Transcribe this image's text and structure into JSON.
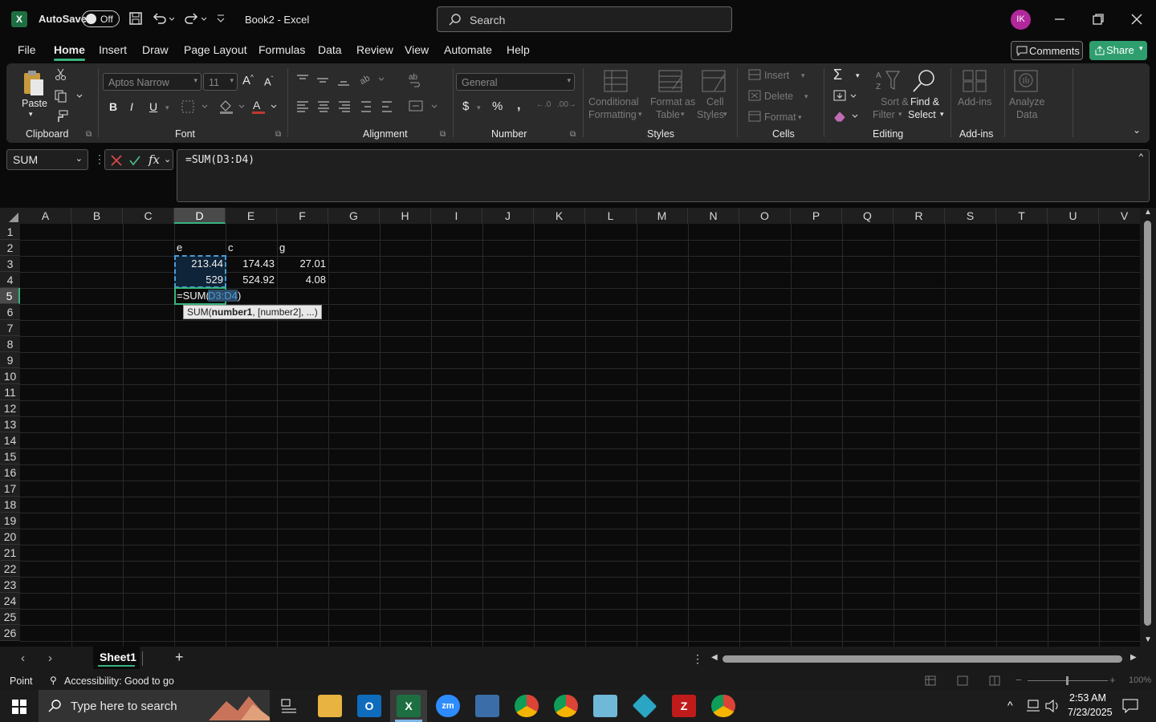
{
  "titlebar": {
    "autosave_label": "AutoSave",
    "autosave_state": "Off",
    "doc_title": "Book2  -  Excel",
    "search_placeholder": "Search",
    "avatar_initials": "IK"
  },
  "tabs": [
    "File",
    "Home",
    "Insert",
    "Draw",
    "Page Layout",
    "Formulas",
    "Data",
    "Review",
    "View",
    "Automate",
    "Help"
  ],
  "active_tab": "Home",
  "comments_label": "Comments",
  "share_label": "Share",
  "ribbon": {
    "clipboard": {
      "group": "Clipboard",
      "paste": "Paste"
    },
    "font": {
      "group": "Font",
      "font_name": "Aptos Narrow",
      "font_size": "11"
    },
    "alignment": {
      "group": "Alignment"
    },
    "number": {
      "group": "Number",
      "format": "General"
    },
    "styles": {
      "group": "Styles",
      "conditional_line1": "Conditional",
      "conditional_line2": "Formatting",
      "format_table_line1": "Format as",
      "format_table_line2": "Table",
      "cell_styles_line1": "Cell",
      "cell_styles_line2": "Styles"
    },
    "cells": {
      "group": "Cells",
      "insert": "Insert",
      "delete": "Delete",
      "format": "Format"
    },
    "editing": {
      "group": "Editing",
      "sort_line1": "Sort &",
      "sort_line2": "Filter",
      "find_line1": "Find &",
      "find_line2": "Select"
    },
    "addins": {
      "group": "Add-ins",
      "addins_label": "Add-ins",
      "analyze_line1": "Analyze",
      "analyze_line2": "Data"
    }
  },
  "formula_bar": {
    "name_box": "SUM",
    "formula": "=SUM(D3:D4)"
  },
  "columns": [
    "A",
    "B",
    "C",
    "D",
    "E",
    "F",
    "G",
    "H",
    "I",
    "J",
    "K",
    "L",
    "M",
    "N",
    "O",
    "P",
    "Q",
    "R",
    "S",
    "T",
    "U",
    "V"
  ],
  "rows": [
    "1",
    "2",
    "3",
    "4",
    "5",
    "6",
    "7",
    "8",
    "9",
    "10",
    "11",
    "12",
    "13",
    "14",
    "15",
    "16",
    "17",
    "18",
    "19",
    "20",
    "21",
    "22",
    "23",
    "24",
    "25",
    "26"
  ],
  "cells": {
    "D2": "e",
    "E2": "c",
    "F2": "g",
    "D3": "213.44",
    "E3": "174.43",
    "F3": "27.01",
    "D4": "529",
    "E4": "524.92",
    "F4": "4.08",
    "D5_prefix": "=SUM(",
    "D5_ref": "D3:D4",
    "D5_suffix": ")"
  },
  "tooltip": {
    "prefix": "SUM(",
    "bold": "number1",
    "suffix": ", [number2], ...)"
  },
  "sheet_tab": "Sheet1",
  "status": {
    "mode": "Point",
    "accessibility": "Accessibility: Good to go",
    "zoom": "100%"
  },
  "taskbar": {
    "search_placeholder": "Type here to search",
    "time": "2:53 AM",
    "date": "7/23/2025"
  }
}
